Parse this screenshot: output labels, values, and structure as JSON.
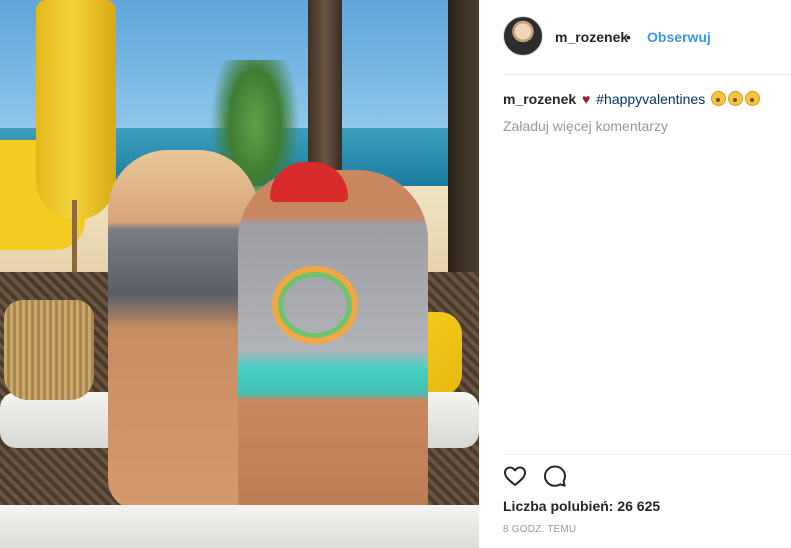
{
  "post": {
    "image_alt": "Beach sofa photo",
    "username": "m_rozenek",
    "separator": "•",
    "follow_label": "Obserwuj",
    "caption": {
      "username": "m_rozenek",
      "heart": "♥",
      "hashtag": "#happyvalentines"
    },
    "load_comments_label": "Załaduj więcej komentarzy",
    "likes_text": "Liczba polubień: 26 625",
    "timestamp": "8 GODZ. TEMU"
  },
  "icons": {
    "like": "heart-outline-icon",
    "comment": "speech-bubble-icon",
    "emoji": "astonished-face-emoji"
  },
  "colors": {
    "link_blue": "#3897f0",
    "hashtag": "#003569",
    "muted": "#999999",
    "heart": "#a01c2c"
  }
}
